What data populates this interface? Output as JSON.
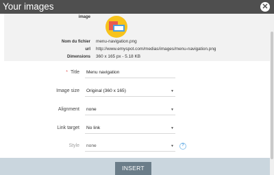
{
  "dialog": {
    "title": "Your images",
    "close_glyph": "✕"
  },
  "image_info": {
    "image_label": "image",
    "filename_label": "Nom du fichier",
    "filename_value": "menu-navigation.png",
    "url_label": "url",
    "url_value": "http://www.emyspot.com/medias/images/menu-navigation.png",
    "dimensions_label": "Dimensions",
    "dimensions_value": "360 x 165 px - 5.18 KB",
    "thumbnail_colors": {
      "circle": "#f7c31c",
      "back_window": "#e9594f",
      "front_window": "#4a9fe0",
      "inner_panel": "#ffffff"
    }
  },
  "form": {
    "title": {
      "required_mark": "*",
      "label": "Title",
      "value": "Menu navigation"
    },
    "image_size": {
      "label": "Image size",
      "value": "Original (360 x 165)",
      "caret": "▼"
    },
    "alignment": {
      "label": "Alignment",
      "value": "none",
      "caret": "▼"
    },
    "link_target": {
      "label": "Link target",
      "value": "No link",
      "caret": "▼"
    },
    "style": {
      "label": "Style",
      "value": "none",
      "caret": "▼",
      "help_glyph": "?"
    }
  },
  "footer": {
    "insert_label": "INSERT"
  }
}
